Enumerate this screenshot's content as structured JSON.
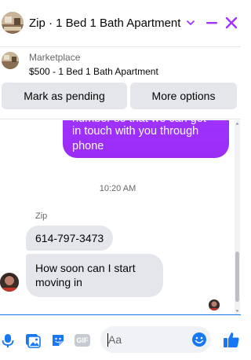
{
  "header": {
    "title": "Zip · 1 Bed 1 Bath Apartment",
    "accent_color": "#a033ff",
    "icons": [
      "listing-thumbnail",
      "chevron-down-icon",
      "minimize-icon",
      "close-icon"
    ]
  },
  "marketplace": {
    "label": "Marketplace",
    "item": "$500 - 1 Bed 1 Bath Apartment",
    "buttons": {
      "mark_pending": "Mark as pending",
      "more_options": "More options"
    }
  },
  "conversation": {
    "outgoing": {
      "lines": [
        "number so that we can get",
        "in touch with you through",
        "phone"
      ],
      "color": "#a033ff"
    },
    "timestamp": "10:20 AM",
    "sender_name": "Zip",
    "incoming": [
      {
        "text": "614-797-3473"
      },
      {
        "text": "How soon can I start moving in"
      }
    ]
  },
  "composer": {
    "placeholder": "Aa",
    "gif_label": "GIF",
    "accent_color": "#1877f2",
    "icons": [
      "microphone-icon",
      "photo-icon",
      "sticker-icon",
      "gif-icon",
      "emoji-icon",
      "thumbs-up-icon"
    ]
  }
}
